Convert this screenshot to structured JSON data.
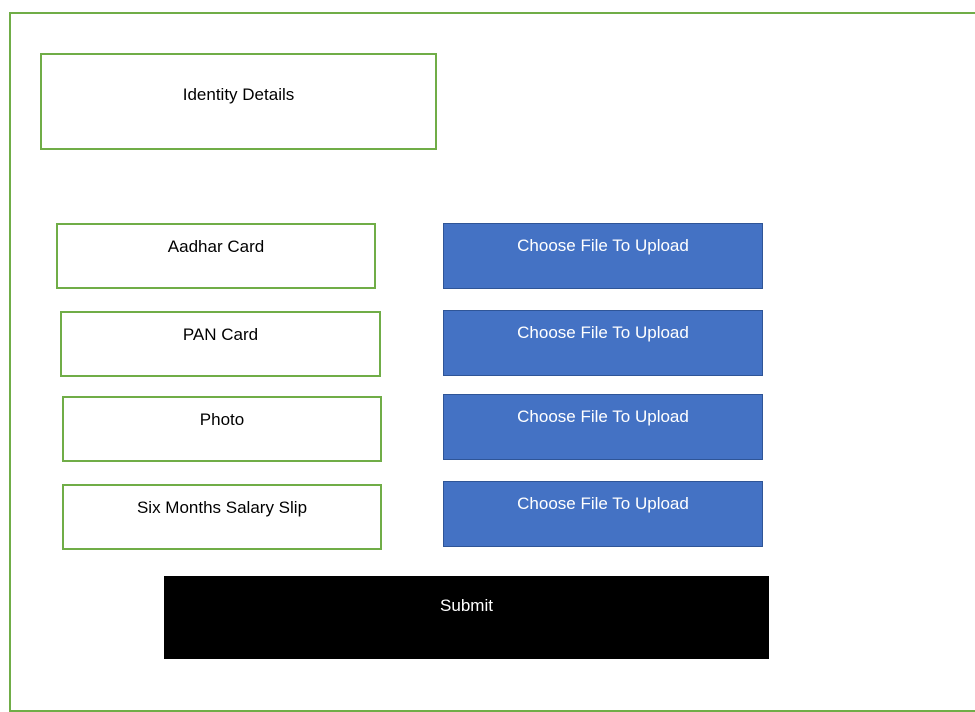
{
  "header": {
    "title": "Identity Details"
  },
  "documents": [
    {
      "label": "Aadhar Card",
      "button_label": "Choose File To Upload"
    },
    {
      "label": "PAN Card",
      "button_label": "Choose File To Upload"
    },
    {
      "label": "Photo",
      "button_label": "Choose File To Upload"
    },
    {
      "label": "Six Months Salary Slip",
      "button_label": "Choose File To Upload"
    }
  ],
  "submit": {
    "label": "Submit"
  },
  "colors": {
    "border_green": "#70ad47",
    "button_blue": "#4472c4",
    "submit_black": "#000000"
  }
}
